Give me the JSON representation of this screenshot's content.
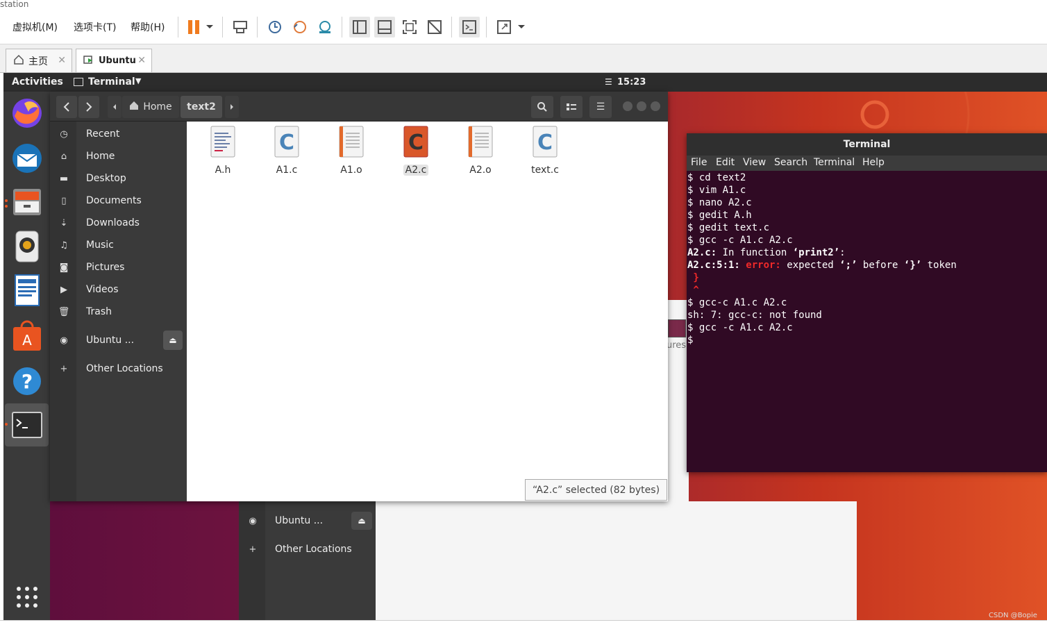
{
  "vmware": {
    "title": "station",
    "menu": [
      {
        "label": "虚拟机(M)"
      },
      {
        "label": "选项卡(T)"
      },
      {
        "label": "帮助(H)"
      }
    ],
    "tabs": [
      {
        "label": "主页"
      },
      {
        "label": "Ubuntu"
      }
    ]
  },
  "ubuntu": {
    "activities": "Activities",
    "app_menu": "Terminal",
    "clock": "15:23"
  },
  "nautilus": {
    "path": [
      {
        "label": "Home"
      },
      {
        "label": "text2"
      }
    ],
    "sidebar": [
      {
        "label": "Recent",
        "icon": "clock-icon"
      },
      {
        "label": "Home",
        "icon": "home-icon"
      },
      {
        "label": "Desktop",
        "icon": "folder-icon"
      },
      {
        "label": "Documents",
        "icon": "document-icon"
      },
      {
        "label": "Downloads",
        "icon": "download-icon"
      },
      {
        "label": "Music",
        "icon": "music-icon"
      },
      {
        "label": "Pictures",
        "icon": "camera-icon"
      },
      {
        "label": "Videos",
        "icon": "video-icon"
      },
      {
        "label": "Trash",
        "icon": "trash-icon"
      },
      {
        "label": "Ubuntu ...",
        "icon": "disc-icon"
      },
      {
        "label": "Other Locations",
        "icon": "plus-icon"
      }
    ],
    "files": [
      {
        "name": "A.h",
        "type": "header"
      },
      {
        "name": "A1.c",
        "type": "c-source"
      },
      {
        "name": "A1.o",
        "type": "object"
      },
      {
        "name": "A2.c",
        "type": "c-source-selected"
      },
      {
        "name": "A2.o",
        "type": "object"
      },
      {
        "name": "text.c",
        "type": "c-source"
      }
    ],
    "status": "“A2.c” selected  (82 bytes)"
  },
  "background_window": {
    "items": [
      {
        "label": "Ubuntu ..."
      },
      {
        "label": "Other Locations"
      }
    ],
    "fragment": "ures"
  },
  "terminal": {
    "title": "Terminal",
    "menu": [
      {
        "label": "File"
      },
      {
        "label": "Edit"
      },
      {
        "label": "View"
      },
      {
        "label": "Search"
      },
      {
        "label": "Terminal"
      },
      {
        "label": "Help"
      }
    ],
    "lines": {
      "l1": "$ cd text2",
      "l2": "$ vim A1.c",
      "l3": "$ nano A2.c",
      "l4": "$ gedit A.h",
      "l5": "$ gedit text.c",
      "l6": "$ gcc -c A1.c A2.c",
      "l7a": "A2.c:",
      "l7b": " In function ",
      "l7c": "‘print2’",
      "l7d": ":",
      "l8a": "A2.c:5:1:",
      "l8b": " error:",
      "l8c": " expected ",
      "l8d": "‘;’",
      "l8e": " before ",
      "l8f": "‘}’",
      "l8g": " token",
      "l9": " }",
      "l10": " ^",
      "l11": "$ gcc-c A1.c A2.c",
      "l12": "sh: 7: gcc-c: not found",
      "l13": "$ gcc -c A1.c A2.c",
      "l14": "$ "
    }
  },
  "watermark": "CSDN @Bopie",
  "colors": {
    "ubuntu_orange": "#e95420",
    "terminal_bg": "#300a24",
    "error_red": "#ef2929"
  }
}
